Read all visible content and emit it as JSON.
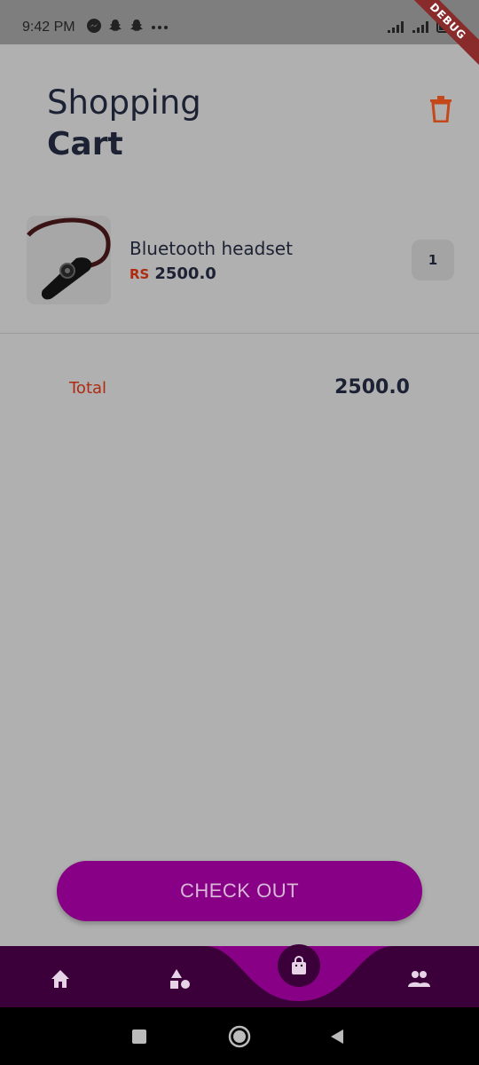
{
  "status_bar": {
    "time": "9:42 PM",
    "icons": [
      "messenger-icon",
      "snapchat-icon",
      "snapchat-icon",
      "more-dots-icon"
    ],
    "right_icons": [
      "signal-icon",
      "signal-icon",
      "battery-icon"
    ],
    "debug_banner": "DEBUG"
  },
  "header": {
    "title_light": "Shopping",
    "title_bold": "Cart",
    "delete_icon": "trash-icon"
  },
  "cart": {
    "items": [
      {
        "name": "Bluetooth headset",
        "currency": "RS",
        "price": "2500.0",
        "quantity": "1",
        "image": "bluetooth-headset-image"
      }
    ]
  },
  "summary": {
    "total_label": "Total",
    "total_value": "2500.0"
  },
  "checkout": {
    "label": "CHECK OUT"
  },
  "bottom_nav": {
    "items": [
      "home-icon",
      "categories-icon",
      "shopping-bag-icon",
      "people-icon"
    ],
    "active": "shopping-bag-icon"
  },
  "system_nav": {
    "buttons": [
      "recents-square-icon",
      "home-circle-icon",
      "back-triangle-icon"
    ]
  },
  "colors": {
    "accent": "#870085",
    "nav_bg": "#3b003a",
    "price_red": "#b02a10",
    "text_dark": "#1c2233"
  }
}
